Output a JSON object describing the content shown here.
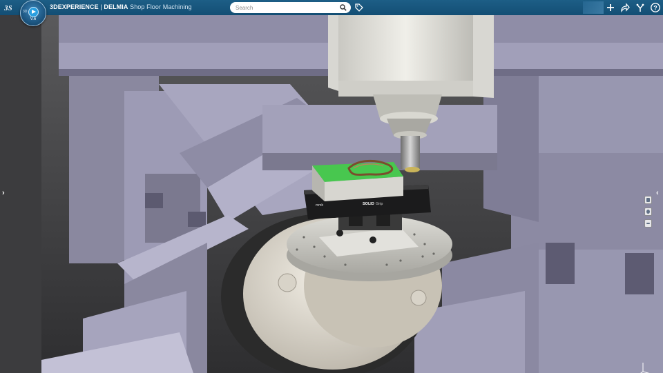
{
  "header": {
    "brand_logo": "3DS",
    "compass_version": "V.6",
    "compass_side_label": "3D",
    "app_title_bold": "3DEXPERIENCE",
    "app_separator": " | ",
    "app_brand": "DELMIA",
    "app_name": "Shop Floor Machining",
    "search_placeholder": "Search"
  },
  "toolbar_icons": [
    "tag-icon",
    "add-icon",
    "share-icon",
    "tools-icon",
    "help-icon"
  ],
  "fixture": {
    "vise_brand": "SOLID",
    "vise_brand_suffix": "Grip",
    "vise_left_mark": "mmb"
  },
  "colors": {
    "topbar": "#185a82",
    "machine_body": "#9a98b2",
    "stock_green": "#3cc04a"
  },
  "nav": {
    "left_arrow": "›",
    "right_arrow": "‹",
    "bottom_arrow": "︿"
  }
}
